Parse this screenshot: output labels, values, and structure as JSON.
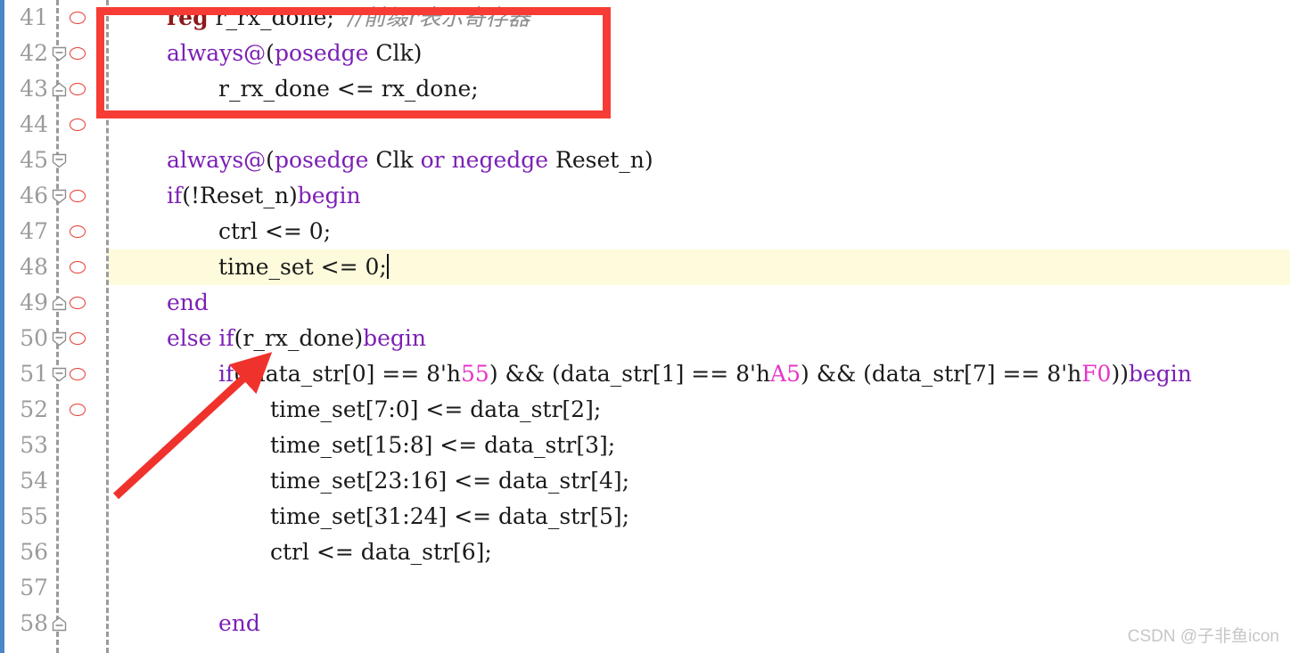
{
  "editor": {
    "language": "verilog",
    "watermark": "CSDN @子非鱼icon",
    "accent_color": "#4a86c8",
    "highlight_color": "#fdfbdc",
    "keyword_color": "#7c20b5",
    "number_color": "#e834c8",
    "comment_color": "#8e8e8e",
    "breakpoint_color": "#e8392e",
    "annotation_color": "#f73c35",
    "lines": [
      {
        "number": "41",
        "breakpoint": true,
        "fold": "none",
        "highlighted": false,
        "indent": 4,
        "tokens": [
          {
            "text": "reg",
            "type": "reg-kw"
          },
          {
            "text": " r_rx_done;  ",
            "type": "plain"
          },
          {
            "text": "//前缀r表示寄存器",
            "type": "cmt"
          }
        ]
      },
      {
        "number": "42",
        "breakpoint": true,
        "fold": "open",
        "highlighted": false,
        "indent": 4,
        "tokens": [
          {
            "text": "always@",
            "type": "kw"
          },
          {
            "text": "(",
            "type": "plain"
          },
          {
            "text": "posedge",
            "type": "kw"
          },
          {
            "text": " Clk)",
            "type": "plain"
          }
        ]
      },
      {
        "number": "43",
        "breakpoint": true,
        "fold": "close",
        "highlighted": false,
        "indent": 8,
        "tokens": [
          {
            "text": "r_rx_done <= rx_done;",
            "type": "plain"
          }
        ]
      },
      {
        "number": "44",
        "breakpoint": true,
        "fold": "none",
        "highlighted": false,
        "indent": 0,
        "tokens": []
      },
      {
        "number": "45",
        "breakpoint": false,
        "fold": "open",
        "highlighted": false,
        "indent": 4,
        "tokens": [
          {
            "text": "always@",
            "type": "kw"
          },
          {
            "text": "(",
            "type": "plain"
          },
          {
            "text": "posedge",
            "type": "kw"
          },
          {
            "text": " Clk ",
            "type": "plain"
          },
          {
            "text": "or",
            "type": "kw"
          },
          {
            "text": " ",
            "type": "plain"
          },
          {
            "text": "negedge",
            "type": "kw"
          },
          {
            "text": " Reset_n)",
            "type": "plain"
          }
        ]
      },
      {
        "number": "46",
        "breakpoint": true,
        "fold": "open",
        "highlighted": false,
        "indent": 4,
        "tokens": [
          {
            "text": "if",
            "type": "kw"
          },
          {
            "text": "(!Reset_n)",
            "type": "plain"
          },
          {
            "text": "begin",
            "type": "kw"
          }
        ]
      },
      {
        "number": "47",
        "breakpoint": true,
        "fold": "none",
        "highlighted": false,
        "indent": 8,
        "tokens": [
          {
            "text": "ctrl <= 0;",
            "type": "plain"
          }
        ]
      },
      {
        "number": "48",
        "breakpoint": true,
        "fold": "none",
        "highlighted": true,
        "indent": 8,
        "tokens": [
          {
            "text": "time_set <= 0;",
            "type": "plain"
          }
        ],
        "caret": true
      },
      {
        "number": "49",
        "breakpoint": true,
        "fold": "close",
        "highlighted": false,
        "indent": 4,
        "tokens": [
          {
            "text": "end",
            "type": "kw"
          }
        ]
      },
      {
        "number": "50",
        "breakpoint": true,
        "fold": "open",
        "highlighted": false,
        "indent": 4,
        "tokens": [
          {
            "text": "else",
            "type": "kw"
          },
          {
            "text": " ",
            "type": "plain"
          },
          {
            "text": "if",
            "type": "kw"
          },
          {
            "text": "(r_rx_done)",
            "type": "plain"
          },
          {
            "text": "begin",
            "type": "kw"
          }
        ]
      },
      {
        "number": "51",
        "breakpoint": true,
        "fold": "open",
        "highlighted": false,
        "indent": 8,
        "tokens": [
          {
            "text": "if",
            "type": "kw"
          },
          {
            "text": "((data_str[0] == 8'h",
            "type": "plain"
          },
          {
            "text": "55",
            "type": "num"
          },
          {
            "text": ") && (data_str[1] == 8'h",
            "type": "plain"
          },
          {
            "text": "A5",
            "type": "num"
          },
          {
            "text": ") && (data_str[7] == 8'h",
            "type": "plain"
          },
          {
            "text": "F0",
            "type": "num"
          },
          {
            "text": "))",
            "type": "plain"
          },
          {
            "text": "begin",
            "type": "kw"
          }
        ]
      },
      {
        "number": "52",
        "breakpoint": true,
        "fold": "none",
        "highlighted": false,
        "indent": 12,
        "tokens": [
          {
            "text": "time_set[7:0] <= data_str[2];",
            "type": "plain"
          }
        ]
      },
      {
        "number": "53",
        "breakpoint": false,
        "fold": "none",
        "highlighted": false,
        "indent": 12,
        "tokens": [
          {
            "text": "time_set[15:8] <= data_str[3];",
            "type": "plain"
          }
        ]
      },
      {
        "number": "54",
        "breakpoint": false,
        "fold": "none",
        "highlighted": false,
        "indent": 12,
        "tokens": [
          {
            "text": "time_set[23:16] <= data_str[4];",
            "type": "plain"
          }
        ]
      },
      {
        "number": "55",
        "breakpoint": false,
        "fold": "none",
        "highlighted": false,
        "indent": 12,
        "tokens": [
          {
            "text": "time_set[31:24] <= data_str[5];",
            "type": "plain"
          }
        ]
      },
      {
        "number": "56",
        "breakpoint": false,
        "fold": "none",
        "highlighted": false,
        "indent": 12,
        "tokens": [
          {
            "text": "ctrl <= data_str[6];",
            "type": "plain"
          }
        ]
      },
      {
        "number": "57",
        "breakpoint": false,
        "fold": "none",
        "highlighted": false,
        "indent": 0,
        "tokens": []
      },
      {
        "number": "58",
        "breakpoint": false,
        "fold": "close",
        "highlighted": false,
        "indent": 8,
        "tokens": [
          {
            "text": "end",
            "type": "kw"
          }
        ]
      }
    ]
  },
  "annotations": {
    "rectangle": {
      "label": "highlight-rectangle",
      "covers_lines": "41-43"
    },
    "arrow": {
      "label": "pointer-arrow",
      "points_to": "r_rx_done in line 50"
    }
  }
}
